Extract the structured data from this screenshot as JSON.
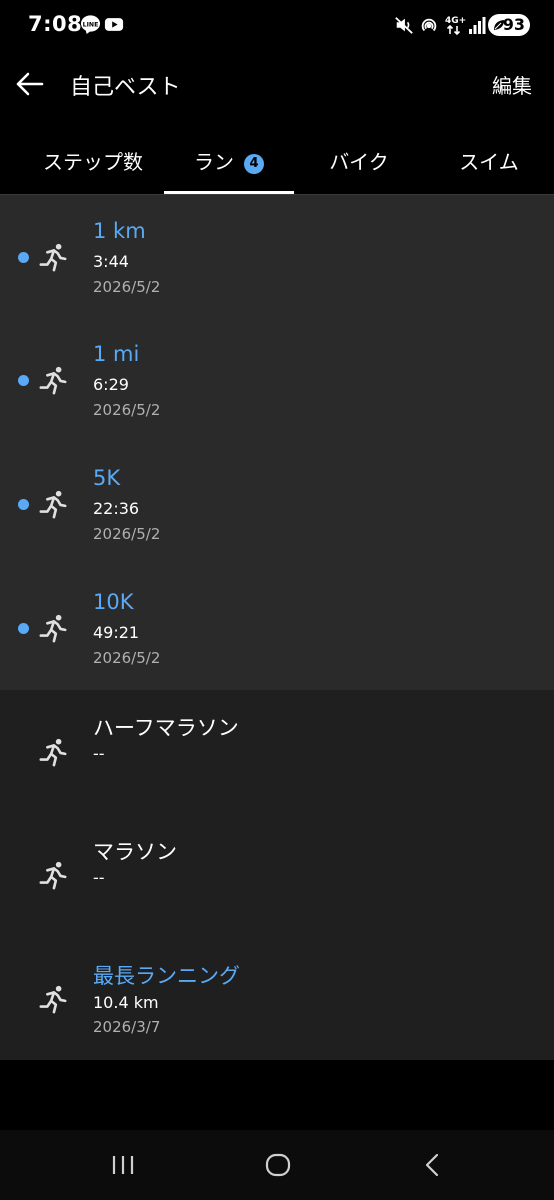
{
  "status_bar": {
    "time": "7:08",
    "app_icons": [
      "line-icon",
      "youtube-icon"
    ],
    "right_icons": [
      "mute-icon",
      "hotspot-icon",
      "network-4g-icon",
      "signal-icon"
    ],
    "network_label": "4G+",
    "battery_level": "93"
  },
  "app_bar": {
    "title": "自己ベスト",
    "edit_label": "編集"
  },
  "tabs": [
    {
      "label": "ステップ数",
      "selected": false
    },
    {
      "label": "ラン",
      "badge": "4",
      "selected": true
    },
    {
      "label": "バイク",
      "selected": false
    },
    {
      "label": "スイム",
      "selected": false
    }
  ],
  "records_achieved": [
    {
      "title": "1 km",
      "value": "3:44",
      "date": "2026/5/2",
      "is_new": true
    },
    {
      "title": "1 mi",
      "value": "6:29",
      "date": "2026/5/2",
      "is_new": true
    },
    {
      "title": "5K",
      "value": "22:36",
      "date": "2026/5/2",
      "is_new": true
    },
    {
      "title": "10K",
      "value": "49:21",
      "date": "2026/5/2",
      "is_new": true
    }
  ],
  "records_other": [
    {
      "title": "ハーフマラソン",
      "value": "--"
    },
    {
      "title": "マラソン",
      "value": "--"
    },
    {
      "title": "最長ランニング",
      "value": "10.4 km",
      "date": "2026/3/7"
    }
  ],
  "colors": {
    "accent": "#5aa9f5",
    "background": "#000000",
    "card_active": "#2a2a2a",
    "card_inactive": "#1f1f1f",
    "secondary_text": "#b0b0b0"
  },
  "nav_bar": {
    "buttons": [
      "recents-icon",
      "home-icon",
      "back-nav-icon"
    ]
  }
}
